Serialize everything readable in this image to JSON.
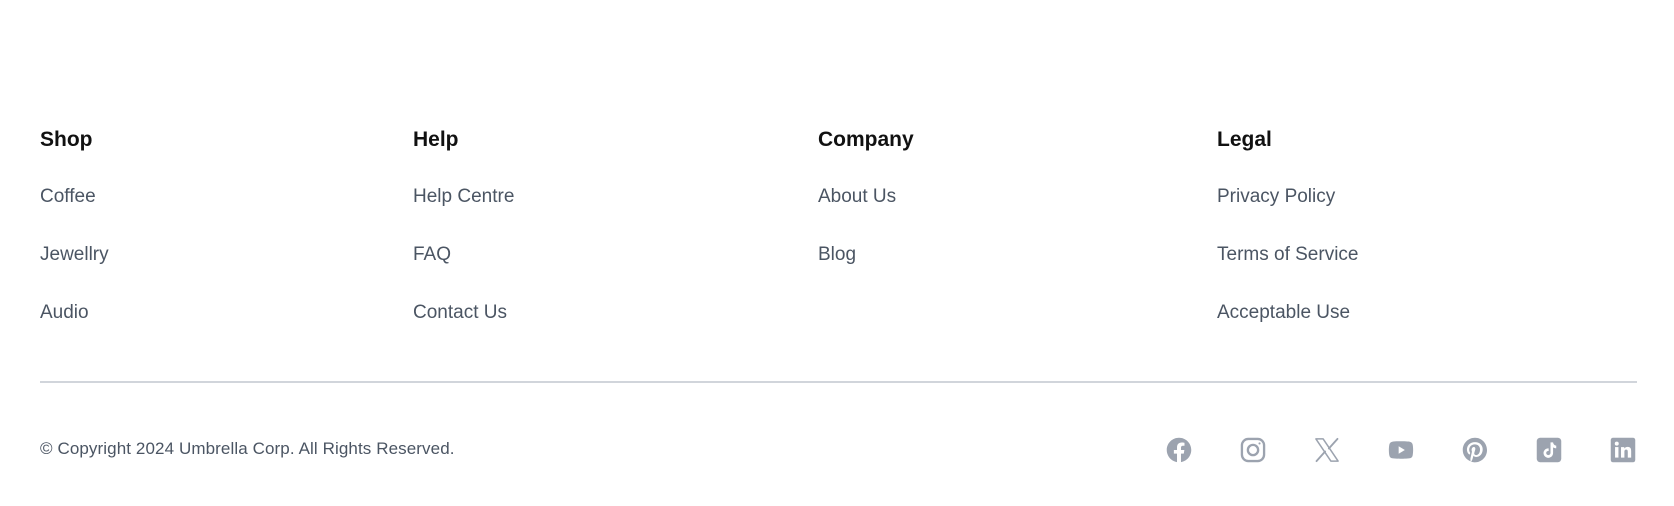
{
  "footer": {
    "columns": [
      {
        "heading": "Shop",
        "links": [
          "Coffee",
          "Jewellry",
          "Audio"
        ]
      },
      {
        "heading": "Help",
        "links": [
          "Help Centre",
          "FAQ",
          "Contact Us"
        ]
      },
      {
        "heading": "Company",
        "links": [
          "About Us",
          "Blog"
        ]
      },
      {
        "heading": "Legal",
        "links": [
          "Privacy Policy",
          "Terms of Service",
          "Acceptable Use"
        ]
      }
    ],
    "copyright": "© Copyright 2024 Umbrella Corp. All Rights Reserved.",
    "social_icons": [
      "facebook-icon",
      "instagram-icon",
      "x-twitter-icon",
      "youtube-icon",
      "pinterest-icon",
      "tiktok-icon",
      "linkedin-icon"
    ],
    "colors": {
      "heading": "#111111",
      "link": "#4b5563",
      "icon": "#9ca3af",
      "divider": "#d1d5db"
    }
  }
}
